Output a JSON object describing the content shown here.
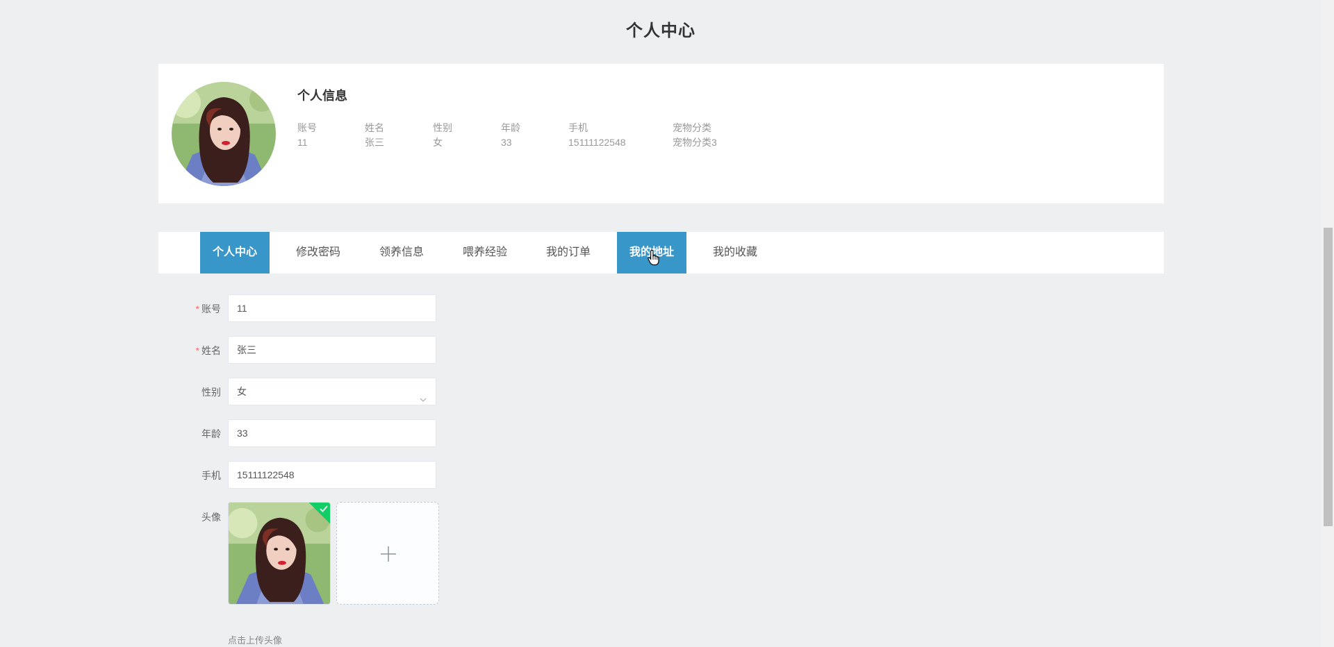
{
  "page": {
    "title": "个人中心"
  },
  "info": {
    "title": "个人信息",
    "fields": [
      {
        "label": "账号",
        "value": "11"
      },
      {
        "label": "姓名",
        "value": "张三"
      },
      {
        "label": "性别",
        "value": "女"
      },
      {
        "label": "年龄",
        "value": "33"
      },
      {
        "label": "手机",
        "value": "15111122548"
      },
      {
        "label": "宠物分类",
        "value": "宠物分类3"
      }
    ]
  },
  "tabs": [
    {
      "label": "个人中心",
      "active": true
    },
    {
      "label": "修改密码",
      "active": false
    },
    {
      "label": "领养信息",
      "active": false
    },
    {
      "label": "喂养经验",
      "active": false
    },
    {
      "label": "我的订单",
      "active": false
    },
    {
      "label": "我的地址",
      "active": true
    },
    {
      "label": "我的收藏",
      "active": false
    }
  ],
  "form": {
    "account": {
      "label": "账号",
      "required_mark": "*",
      "value": "11"
    },
    "name": {
      "label": "姓名",
      "required_mark": "*",
      "value": "张三"
    },
    "gender": {
      "label": "性别",
      "value": "女"
    },
    "age": {
      "label": "年龄",
      "value": "33"
    },
    "phone": {
      "label": "手机",
      "value": "15111122548"
    },
    "avatar": {
      "label": "头像",
      "tip": "点击上传头像"
    }
  },
  "icons": {
    "dropdown": "chevron-down-icon",
    "upload": "plus-icon",
    "success": "check-icon",
    "cursor": "hand-pointer-icon"
  },
  "colors": {
    "accent": "#3896c8",
    "background": "#eeeff1",
    "required": "#f56c6c",
    "success": "#13ce66"
  }
}
